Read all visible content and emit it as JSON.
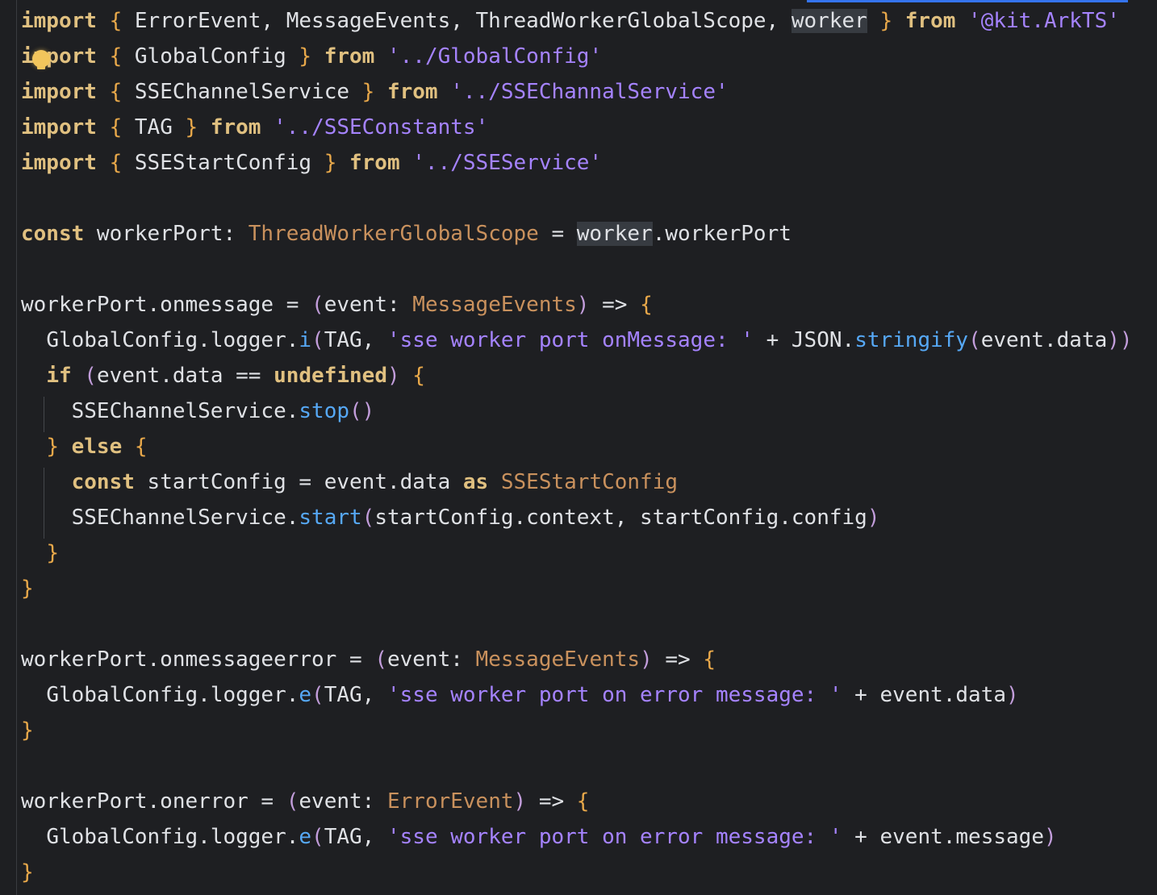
{
  "editor": {
    "lines": [
      {
        "id": "l1"
      },
      {
        "id": "l2"
      }
    ],
    "import1": {
      "kw": "import",
      "ob": "{",
      "names": " ErrorEvent, MessageEvents, ThreadWorkerGlobalScope, ",
      "worker": "worker",
      "cb": "}",
      "from": "from",
      "path": "'@kit.ArkTS'"
    },
    "import2": {
      "kw": "import",
      "ob": "{",
      "names": " GlobalConfig ",
      "cb": "}",
      "from": "from",
      "path": "'../GlobalConfig'"
    },
    "import3": {
      "kw": "import",
      "ob": "{",
      "names": " SSEChannelService ",
      "cb": "}",
      "from": "from",
      "path": "'../SSEChannalService'"
    },
    "import4": {
      "kw": "import",
      "ob": "{",
      "names": " TAG ",
      "cb": "}",
      "from": "from",
      "path": "'../SSEConstants'"
    },
    "import5": {
      "kw": "import",
      "ob": "{",
      "names": " SSEStartConfig ",
      "cb": "}",
      "from": "from",
      "path": "'../SSEService'"
    },
    "decl": {
      "kw": "const",
      "name": " workerPort",
      "colon": ":",
      "type": " ThreadWorkerGlobalScope",
      "eq": " = ",
      "worker": "worker",
      "rest": ".workerPort"
    },
    "onmessage": {
      "head": "workerPort.onmessage",
      "eq": " = ",
      "open": "(",
      "param": "event",
      "colon": ":",
      "type": " MessageEvents",
      "close": ")",
      "arrow": " => ",
      "ob": "{",
      "log_obj": "GlobalConfig",
      "log_dot1": ".",
      "log_logger": "logger",
      "log_dot2": ".",
      "log_fn": "i",
      "log_open": "(",
      "log_tag": "TAG, ",
      "log_str": "'sse worker port onMessage: '",
      "log_plus": " + ",
      "log_json": "JSON",
      "log_dot3": ".",
      "log_stringify": "stringify",
      "log_open2": "(",
      "log_arg": "event.data",
      "log_close": "))",
      "if_kw": "if",
      "if_open": " (",
      "if_cond": "event.data == ",
      "if_undef": "undefined",
      "if_close": ")",
      "if_ob": " {",
      "stop_obj": "SSEChannelService",
      "stop_dot": ".",
      "stop_fn": "stop",
      "stop_paren": "()",
      "else_cb": "}",
      "else_kw": " else",
      "else_ob": " {",
      "c_kw": "const",
      "c_name": " startConfig = event.data ",
      "c_as": "as",
      "c_type": " SSEStartConfig",
      "start_obj": "SSEChannelService",
      "start_dot": ".",
      "start_fn": "start",
      "start_open": "(",
      "start_args": "startConfig.context, startConfig.config",
      "start_close": ")",
      "inner_cb": "}",
      "outer_cb": "}"
    },
    "onmessageerror": {
      "head": "workerPort.onmessageerror",
      "eq": " = ",
      "open": "(",
      "param": "event",
      "colon": ":",
      "type": " MessageEvents",
      "close": ")",
      "arrow": " => ",
      "ob": "{",
      "log_obj": "GlobalConfig",
      "log_dot1": ".",
      "log_logger": "logger",
      "log_dot2": ".",
      "log_fn": "e",
      "log_open": "(",
      "log_tag": "TAG, ",
      "log_str": "'sse worker port on error message: '",
      "log_plus": " + ",
      "log_arg": "event.data",
      "log_close": ")",
      "cb": "}"
    },
    "onerror": {
      "head": "workerPort.onerror",
      "eq": " = ",
      "open": "(",
      "param": "event",
      "colon": ":",
      "type": " ErrorEvent",
      "close": ")",
      "arrow": " => ",
      "ob": "{",
      "log_obj": "GlobalConfig",
      "log_dot1": ".",
      "log_logger": "logger",
      "log_dot2": ".",
      "log_fn": "e",
      "log_open": "(",
      "log_tag": "TAG, ",
      "log_str": "'sse worker port on error message: '",
      "log_plus": " + ",
      "log_arg": "event.message",
      "log_close": ")",
      "cb": "}"
    }
  },
  "colors": {
    "background": "#1e1f22",
    "keyword": "#e0c080",
    "string": "#a583ff",
    "type": "#c9915d",
    "function": "#56a8f5",
    "brace": "#e8a84a"
  }
}
